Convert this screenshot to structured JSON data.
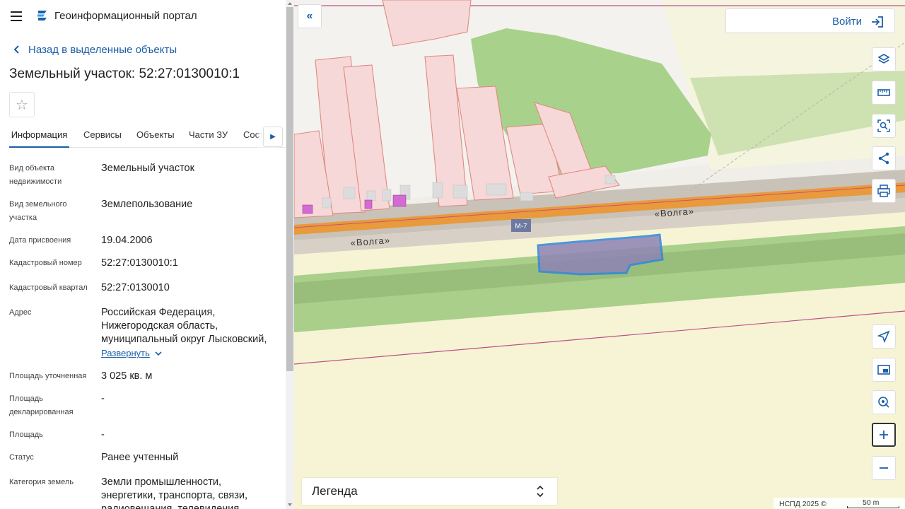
{
  "app": {
    "title": "Геоинформационный портал"
  },
  "back_link": "Назад в выделенные объекты",
  "object_title": "Земельный участок: 52:27:0130010:1",
  "tabs": [
    {
      "label": "Информация",
      "active": true
    },
    {
      "label": "Сервисы"
    },
    {
      "label": "Объекты"
    },
    {
      "label": "Части ЗУ"
    },
    {
      "label": "Соста"
    }
  ],
  "properties": [
    {
      "label": "Вид объекта недвижимости",
      "value": "Земельный участок"
    },
    {
      "label": "Вид земельного участка",
      "value": "Землепользование"
    },
    {
      "label": "Дата присвоения",
      "value": "19.04.2006"
    },
    {
      "label": "Кадастровый номер",
      "value": "52:27:0130010:1"
    },
    {
      "label": "Кадастровый квартал",
      "value": "52:27:0130010"
    },
    {
      "label": "Адрес",
      "value": "Российская Федерация, Нижегородская область, муниципальный округ Лысковский,"
    },
    {
      "label": "Площадь уточненная",
      "value": "3 025 кв. м"
    },
    {
      "label": "Площадь декларированная",
      "value": "-"
    },
    {
      "label": "Площадь",
      "value": "-"
    },
    {
      "label": "Статус",
      "value": "Ранее учтенный"
    },
    {
      "label": "Категория земель",
      "value": "Земли промышленности, энергетики, транспорта, связи, радиовещания, телевидения,"
    }
  ],
  "expand_label": "Развернуть",
  "map": {
    "road_label_1": "«Волга»",
    "road_label_2": "«Волга»",
    "route_badge": "М-7",
    "login_label": "Войти",
    "legend_label": "Легенда",
    "copyright": "НСПД 2025 ©",
    "scale_label": "50 m"
  },
  "colors": {
    "accent": "#1a5fa8",
    "parcel_fill": "#f6d8d8",
    "parcel_stroke": "#e08a80",
    "green": "#a9d18e",
    "road": "#e89a3c",
    "selection": "#2f86de"
  },
  "icons": {
    "menu": "menu-icon",
    "logo": "portal-logo-icon",
    "back": "chevron-left-icon",
    "favorite": "star-icon",
    "layers": "layers-icon",
    "ruler": "ruler-icon",
    "search_area": "search-area-icon",
    "share": "share-icon",
    "print": "print-icon",
    "locate": "locate-icon",
    "minimap": "minimap-icon",
    "pin": "pin-icon",
    "zoom_in": "plus-icon",
    "zoom_out": "minus-icon"
  }
}
